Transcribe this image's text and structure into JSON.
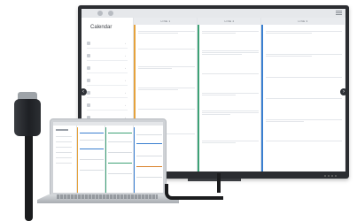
{
  "calendar": {
    "title": "Calendar",
    "days": [
      {
        "label": "LINE 1",
        "accent": "#e6a23c"
      },
      {
        "label": "LINE 2",
        "accent": "#3ea276"
      },
      {
        "label": "LINE 3",
        "accent": "#3a7fd0"
      }
    ]
  },
  "colors": {
    "bezel": "#2b2d31",
    "screen_bg": "#f1f2f4",
    "accent_blue": "#3a7fd0",
    "accent_green": "#3ea276",
    "accent_orange": "#e6a23c"
  },
  "icons": {
    "nav_prev": "chevron-left-icon",
    "nav_next": "chevron-right-icon",
    "menu": "hamburger-menu-icon"
  }
}
